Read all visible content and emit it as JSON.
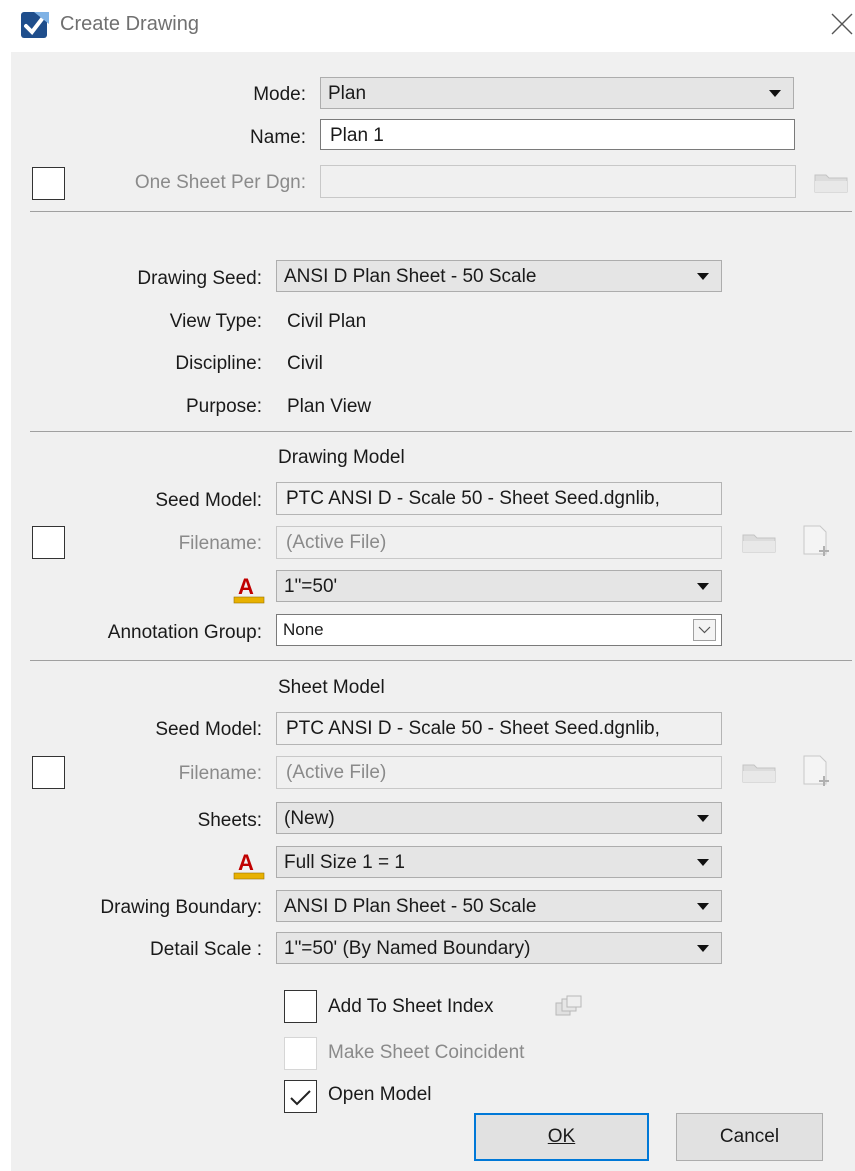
{
  "window": {
    "title": "Create Drawing",
    "app_icon": "microstation-icon",
    "close_icon": "close-icon"
  },
  "top": {
    "mode_label": "Mode:",
    "mode_value": "Plan",
    "name_label": "Name:",
    "name_value": "Plan 1",
    "one_sheet_label": "One Sheet Per Dgn:",
    "one_sheet_value": "",
    "one_sheet_checked": false
  },
  "drawing_seed": {
    "seed_label": "Drawing Seed:",
    "seed_value": "ANSI D Plan Sheet - 50 Scale",
    "view_type_label": "View Type:",
    "view_type_value": "Civil Plan",
    "discipline_label": "Discipline:",
    "discipline_value": "Civil",
    "purpose_label": "Purpose:",
    "purpose_value": "Plan View"
  },
  "drawing_model": {
    "heading": "Drawing Model",
    "seed_model_label": "Seed Model:",
    "seed_model_value": "PTC ANSI D - Scale 50 - Sheet Seed.dgnlib,",
    "filename_label": "Filename:",
    "filename_value": "(Active File)",
    "filename_checked": false,
    "scale_value": "1\"=50'",
    "annotation_group_label": "Annotation Group:",
    "annotation_group_value": "None"
  },
  "sheet_model": {
    "heading": "Sheet Model",
    "seed_model_label": "Seed Model:",
    "seed_model_value": "PTC ANSI D - Scale 50 - Sheet Seed.dgnlib,",
    "filename_label": "Filename:",
    "filename_value": "(Active File)",
    "filename_checked": false,
    "sheets_label": "Sheets:",
    "sheets_value": "(New)",
    "scale_value": "Full Size 1 = 1",
    "boundary_label": "Drawing Boundary:",
    "boundary_value": "ANSI D Plan Sheet - 50 Scale",
    "detail_scale_label": "Detail Scale :",
    "detail_scale_value": "1\"=50' (By Named Boundary)"
  },
  "options": {
    "add_to_index_label": "Add To Sheet Index",
    "add_to_index_checked": false,
    "coincident_label": "Make Sheet Coincident",
    "coincident_checked": false,
    "open_model_label": "Open Model",
    "open_model_checked": true
  },
  "buttons": {
    "ok_label": "OK",
    "cancel_label": "Cancel"
  },
  "colors": {
    "accent": "#0078d7",
    "annotation_red": "#c00000",
    "dialog_bg": "#f0f0f0"
  }
}
